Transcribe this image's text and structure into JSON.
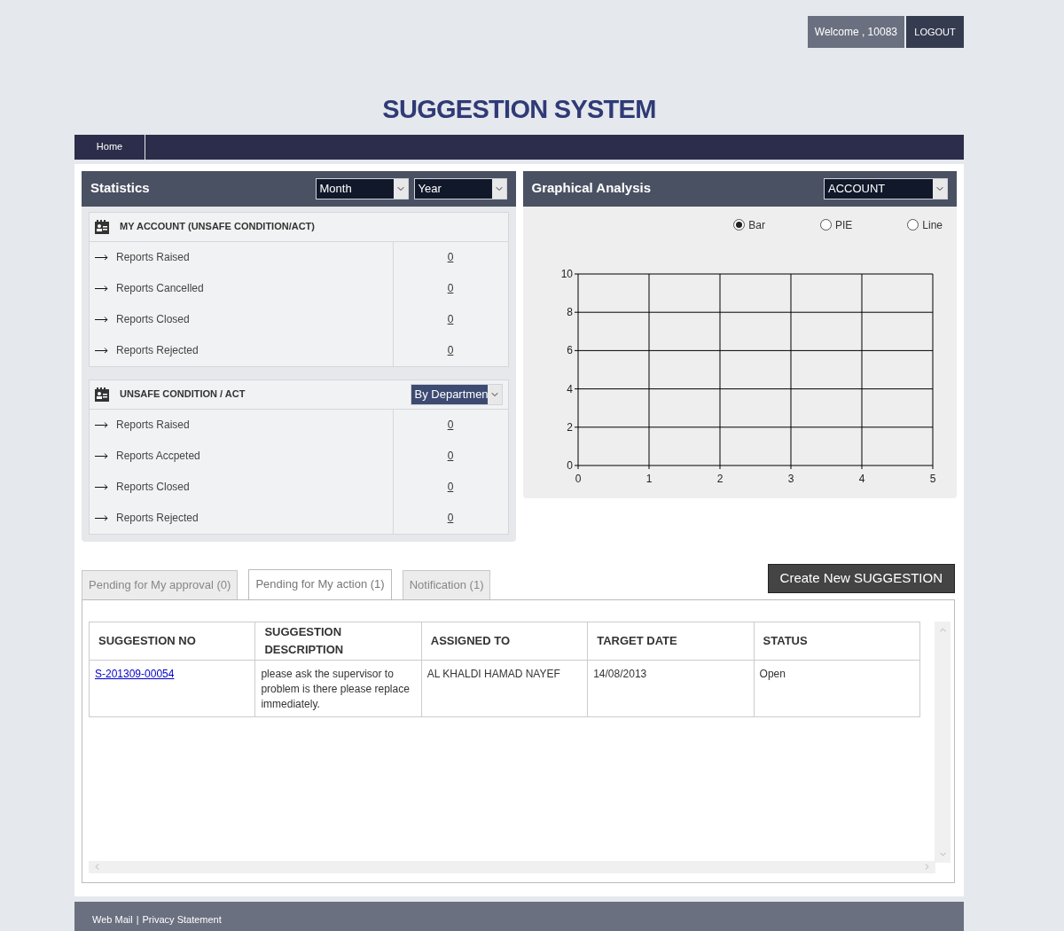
{
  "header": {
    "welcome": "Welcome , 10083",
    "logout": "LOGOUT"
  },
  "title": "SUGGESTION SYSTEM",
  "nav": [
    "Home"
  ],
  "statistics": {
    "title": "Statistics",
    "selects": [
      "Month",
      "Year"
    ],
    "sections": [
      {
        "title": "MY ACCOUNT (UNSAFE CONDITION/ACT)",
        "rows": [
          {
            "label": "Reports Raised",
            "value": "0"
          },
          {
            "label": "Reports Cancelled",
            "value": "0"
          },
          {
            "label": "Reports Closed",
            "value": "0"
          },
          {
            "label": "Reports Rejected",
            "value": "0"
          }
        ]
      },
      {
        "title": "UNSAFE CONDITION / ACT",
        "select": "By Departmen",
        "rows": [
          {
            "label": "Reports Raised",
            "value": "0"
          },
          {
            "label": "Reports Accpeted",
            "value": "0"
          },
          {
            "label": "Reports Closed",
            "value": "0"
          },
          {
            "label": "Reports Rejected",
            "value": "0"
          }
        ]
      }
    ]
  },
  "graphical_analysis": {
    "title": "Graphical Analysis",
    "select": "ACCOUNT",
    "chart_types": [
      {
        "label": "Bar",
        "selected": true
      },
      {
        "label": "PIE",
        "selected": false
      },
      {
        "label": "Line",
        "selected": false
      }
    ],
    "chart_data": {
      "type": "bar",
      "grid": true,
      "xlim": [
        0,
        5
      ],
      "ylim": [
        0,
        10
      ],
      "xticks": [
        0,
        1,
        2,
        3,
        4,
        5
      ],
      "yticks": [
        0,
        2,
        4,
        6,
        8,
        10
      ]
    }
  },
  "tabs": [
    {
      "label": "Pending for My approval (0)",
      "selected": false
    },
    {
      "label": "Pending for My action (1)",
      "selected": true
    },
    {
      "label": "Notification (1)",
      "selected": false
    }
  ],
  "create_button": "Create New SUGGESTION",
  "table": {
    "columns": [
      "SUGGESTION NO",
      "SUGGESTION DESCRIPTION",
      "ASSIGNED TO",
      "TARGET DATE",
      "STATUS"
    ],
    "rows": [
      [
        "S-201309-00054",
        "please ask the supervisor to problem is there please replace immediately.",
        "AL KHALDI HAMAD NAYEF",
        "14/08/2013",
        "Open"
      ]
    ]
  },
  "footer": {
    "links": [
      "Web Mail",
      "Privacy Statement"
    ],
    "separator": "|"
  }
}
